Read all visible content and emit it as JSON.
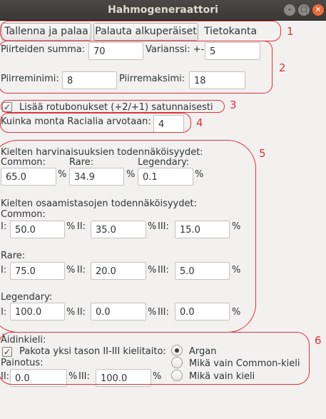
{
  "window": {
    "title": "Hahmogeneraattori",
    "min_glyph": "–",
    "max_glyph": "□",
    "close_glyph": "×"
  },
  "toolbar": {
    "save_label": "Tallenna ja palaa",
    "restore_label": "Palauta alkuperäiset",
    "database_label": "Tietokanta"
  },
  "stats": {
    "sum_label": "Piirteiden summa:",
    "sum_value": "70",
    "variance_label": "Varianssi: +-",
    "variance_value": "5",
    "min_label": "Piirreminimi:",
    "min_value": "8",
    "max_label": "Piirremaksimi:",
    "max_value": "18"
  },
  "race_bonus": {
    "label": "Lisää rotubonukset (+2/+1) satunnaisesti",
    "checked": true,
    "check_glyph": "✓"
  },
  "racials": {
    "label": "Kuinka monta Racialia arvotaan:",
    "value": "4"
  },
  "language_rarity": {
    "heading": "Kielten harvinaisuuksien todennäköisyydet:",
    "common_label": "Common:",
    "common_value": "65.0",
    "rare_label": "Rare:",
    "rare_value": "34.9",
    "legendary_label": "Legendary:",
    "legendary_value": "0.1",
    "percent": "%"
  },
  "language_skill": {
    "heading": "Kielten osaamistasojen todennäköisyydet:",
    "level_labels": [
      "I:",
      "II:",
      "III:"
    ],
    "groups": [
      {
        "label": "Common:",
        "values": [
          "50.0",
          "35.0",
          "15.0"
        ]
      },
      {
        "label": "Rare:",
        "values": [
          "75.0",
          "20.0",
          "5.0"
        ]
      },
      {
        "label": "Legendary:",
        "values": [
          "100.0",
          "0.0",
          "0.0"
        ]
      }
    ]
  },
  "mother_tongue": {
    "heading": "Äidinkieli:",
    "force_label": "Pakota yksi tason II-III kielitaito:",
    "force_checked": true,
    "weighting_label": "Painotus:",
    "weight_ii_label": "II:",
    "weight_ii_value": "0.0",
    "weight_iii_label": "III:",
    "weight_iii_value": "100.0",
    "options": [
      "Argan",
      "Mikä vain Common-kieli",
      "Mikä vain kieli"
    ],
    "selected_index": 0
  },
  "annotations": [
    "1",
    "2",
    "3",
    "4",
    "5",
    "6"
  ],
  "colors": {
    "annotation": "#e0313a",
    "titlebar": "#3c3b37",
    "window_bg": "#f2f1f0"
  }
}
